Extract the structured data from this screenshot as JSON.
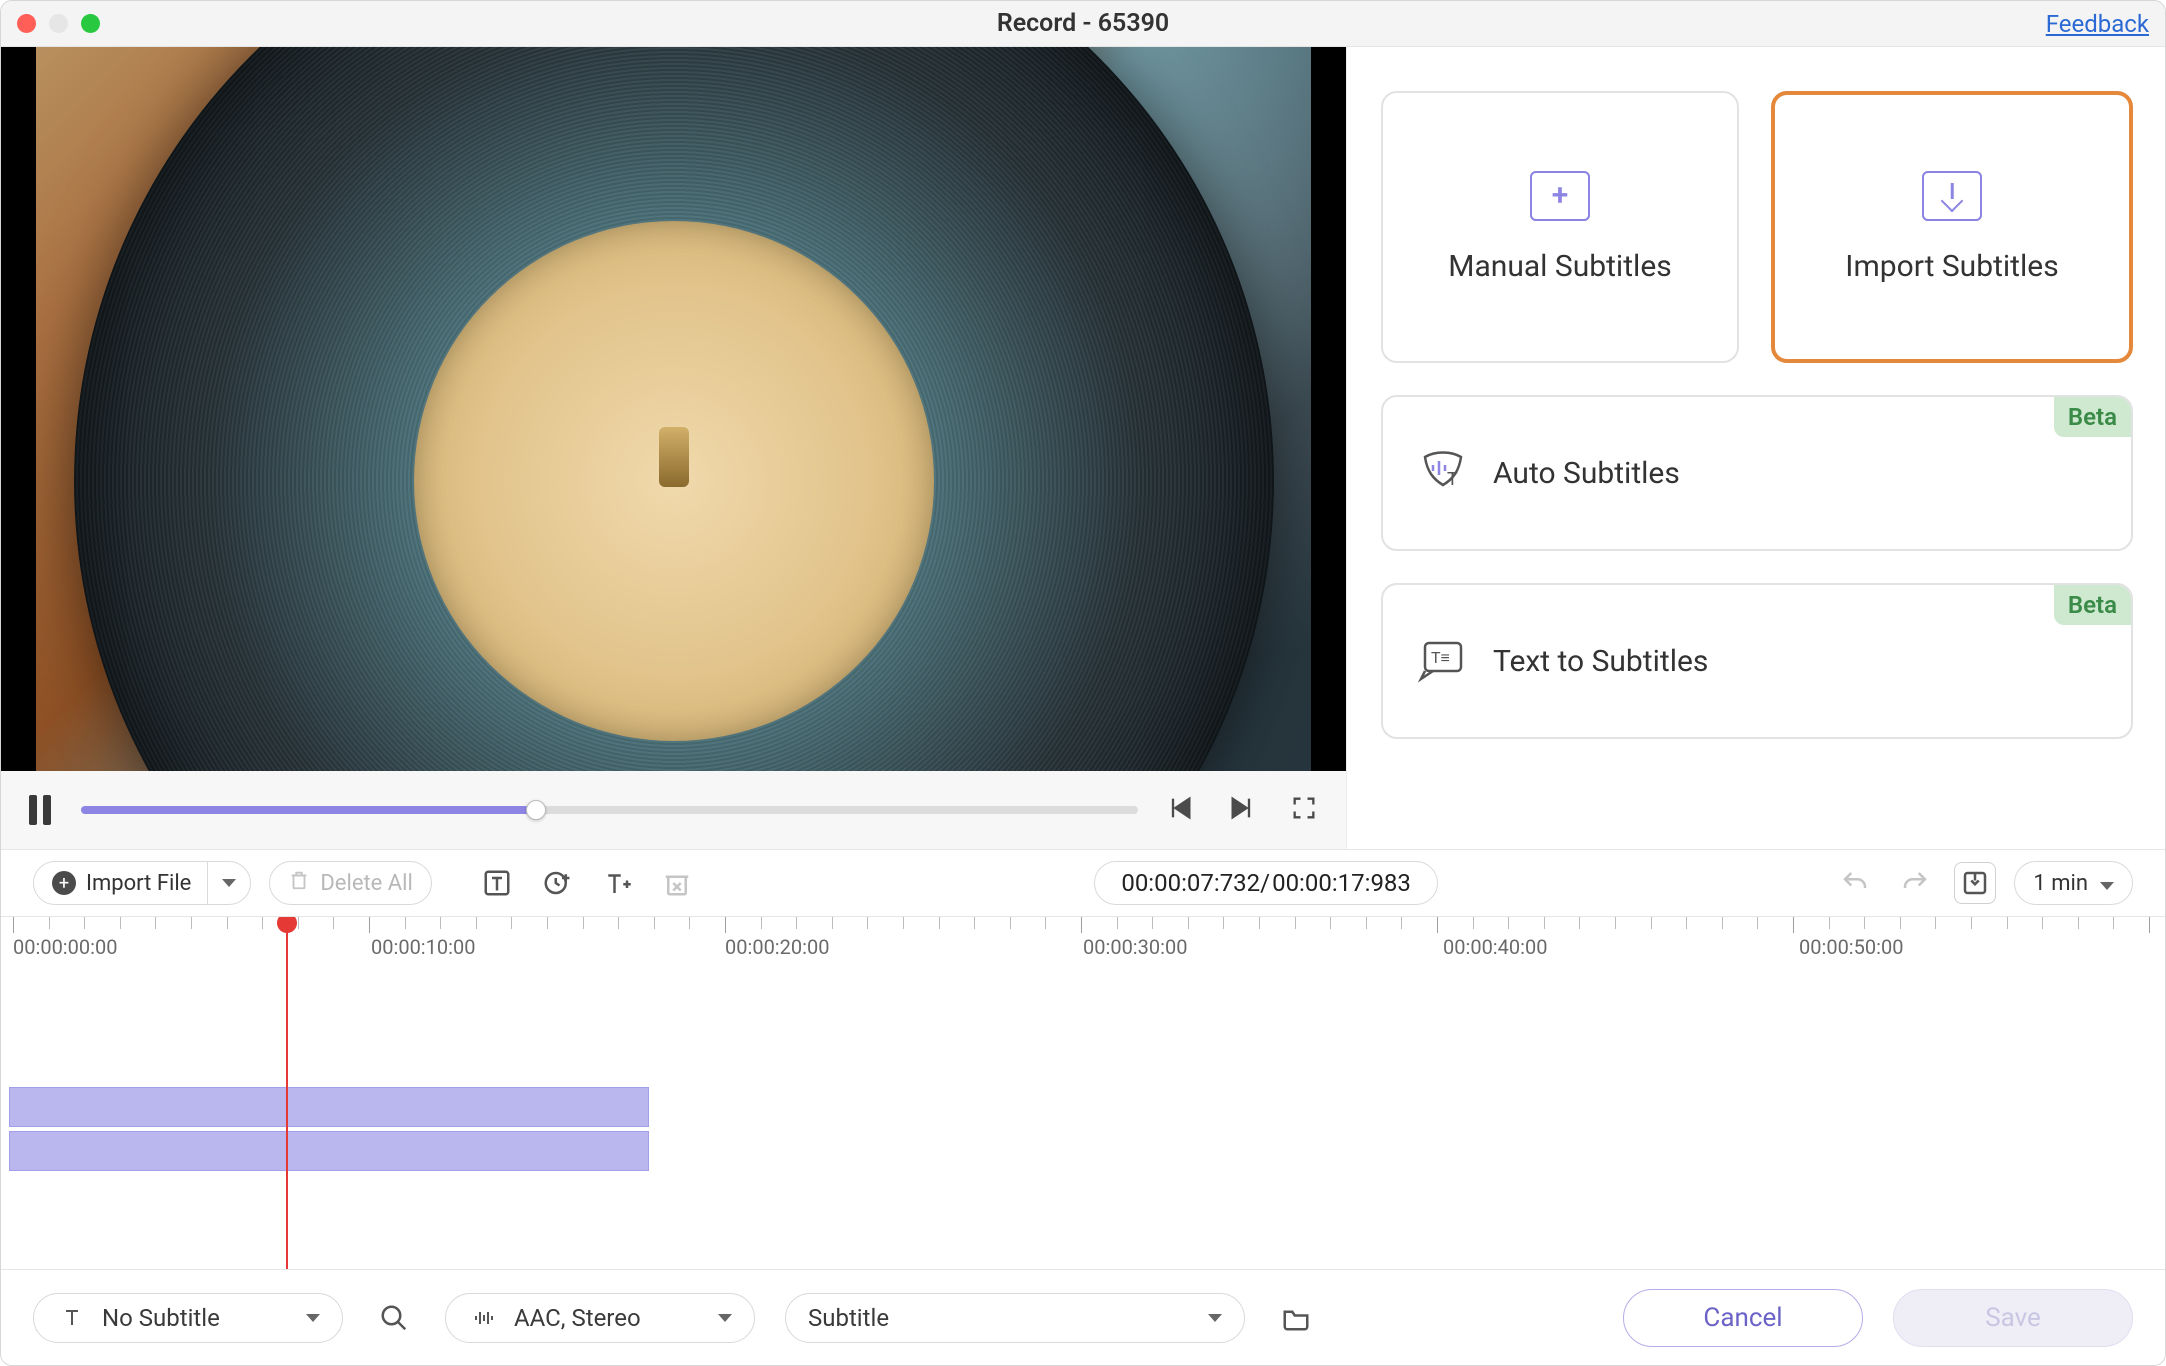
{
  "titlebar": {
    "title": "Record - 65390",
    "feedback": "Feedback"
  },
  "panel": {
    "manual_subtitles": "Manual Subtitles",
    "import_subtitles": "Import Subtitles",
    "auto_subtitles": "Auto Subtitles",
    "text_to_subtitles": "Text to Subtitles",
    "beta": "Beta"
  },
  "toolbar": {
    "import_file": "Import File",
    "delete_all": "Delete All",
    "time_current": "00:00:07:732",
    "time_total": "00:00:17:983",
    "time_sep": "/ ",
    "zoom": "1 min"
  },
  "timeline": {
    "t0": "00:00:00:00",
    "t10": "00:00:10:00",
    "t20": "00:00:20:00",
    "t30": "00:00:30:00",
    "t40": "00:00:40:00",
    "t50": "00:00:50:00"
  },
  "bottom": {
    "subtitle_select": "No Subtitle",
    "audio_select": "AAC, Stereo",
    "track_select": "Subtitle",
    "cancel": "Cancel",
    "save": "Save"
  }
}
